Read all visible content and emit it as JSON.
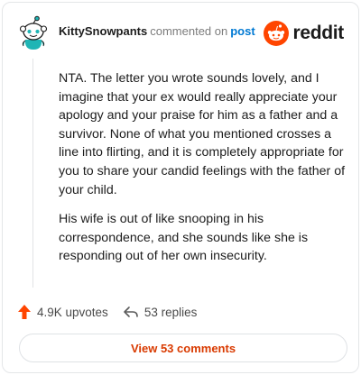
{
  "header": {
    "username": "KittySnowpants",
    "action_text": "commented on",
    "post_link": "post",
    "brand": "reddit"
  },
  "comment": {
    "paragraphs": [
      "NTA. The letter you wrote sounds lovely, and I imagine that your ex would really appreciate your apology and your praise for him as a father and a survivor. None of what you mentioned crosses a line into flirting, and it is completely appropriate for you to share your candid feelings with the father of your child.",
      "His wife is out of like snooping in his correspondence, and she sounds like she is responding out of her own insecurity."
    ]
  },
  "actions": {
    "upvotes": "4.9K upvotes",
    "replies": "53 replies"
  },
  "footer": {
    "view_comments": "View 53 comments"
  },
  "colors": {
    "reddit_orange": "#ff4500",
    "link_blue": "#0079d3",
    "view_button_text": "#d93a00",
    "avatar_teal": "#1fb5b5"
  },
  "icons": {
    "avatar": "snoo-avatar-icon",
    "brand": "reddit-logo-icon",
    "upvote": "upvote-arrow-icon",
    "reply": "reply-arrow-icon"
  }
}
